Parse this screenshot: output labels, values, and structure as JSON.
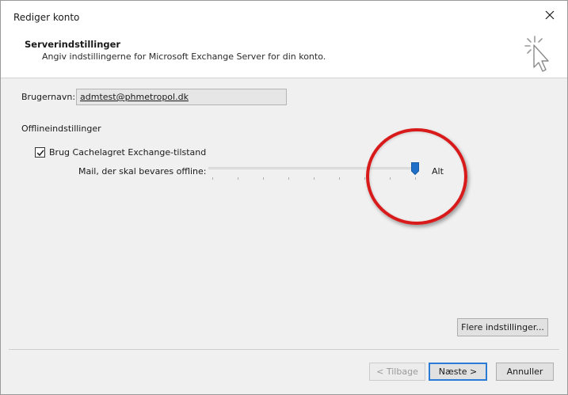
{
  "window": {
    "title": "Rediger konto"
  },
  "header": {
    "title": "Serverindstillinger",
    "subtitle": "Angiv indstillingerne for Microsoft Exchange Server for din konto.",
    "icon": "cursor-click-icon"
  },
  "form": {
    "username_label": "Brugernavn:",
    "username_value": "admtest@phmetropol.dk",
    "offline_section_title": "Offlineindstillinger",
    "cached_mode_label": "Brug Cachelagret Exchange-tilstand",
    "cached_mode_checked": true,
    "slider_label": "Mail, der skal bevares offline:",
    "slider_value_label": "Alt",
    "slider_position_fraction": 1.0,
    "slider_tick_count": 9
  },
  "annotation": {
    "circle_color": "#d81a1a"
  },
  "buttons": {
    "more_settings": "Flere indstillinger...",
    "back": "< Tilbage",
    "next": "Næste >",
    "cancel": "Annuller"
  },
  "colors": {
    "accent": "#2a7ad6",
    "slider_thumb": "#1e6fc7"
  }
}
